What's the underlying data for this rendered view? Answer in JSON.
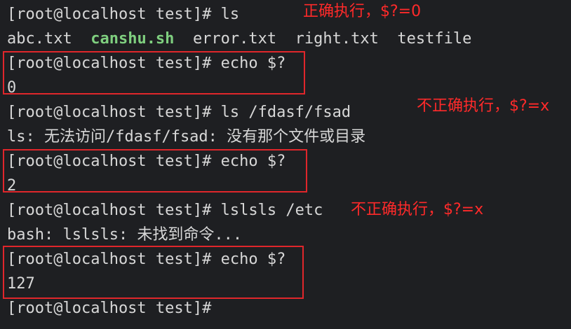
{
  "terminal": {
    "lines": [
      {
        "text": "[root@localhost test]# ls"
      },
      {
        "files": [
          "abc.txt",
          "canshu.sh",
          "error.txt",
          "right.txt",
          "testfile"
        ]
      },
      {
        "text": "[root@localhost test]# echo $?"
      },
      {
        "text": "0"
      },
      {
        "text": "[root@localhost test]# ls /fdasf/fsad"
      },
      {
        "text": "ls: 无法访问/fdasf/fsad: 没有那个文件或目录"
      },
      {
        "text": "[root@localhost test]# echo $?"
      },
      {
        "text": "2"
      },
      {
        "text": "[root@localhost test]# lslsls /etc"
      },
      {
        "text": "bash: lslsls: 未找到命令..."
      },
      {
        "text": "[root@localhost test]# echo $?"
      },
      {
        "text": "127"
      },
      {
        "text": "[root@localhost test]#"
      }
    ]
  },
  "annotations": [
    {
      "text": "正确执行，$?=0"
    },
    {
      "text": "不正确执行，$?=x"
    },
    {
      "text": "不正确执行，$?=x"
    }
  ],
  "colors": {
    "background": "#1e1f22",
    "text": "#d7d7d7",
    "executable": "#7fcf7f",
    "annotation": "#ff2a2a"
  }
}
